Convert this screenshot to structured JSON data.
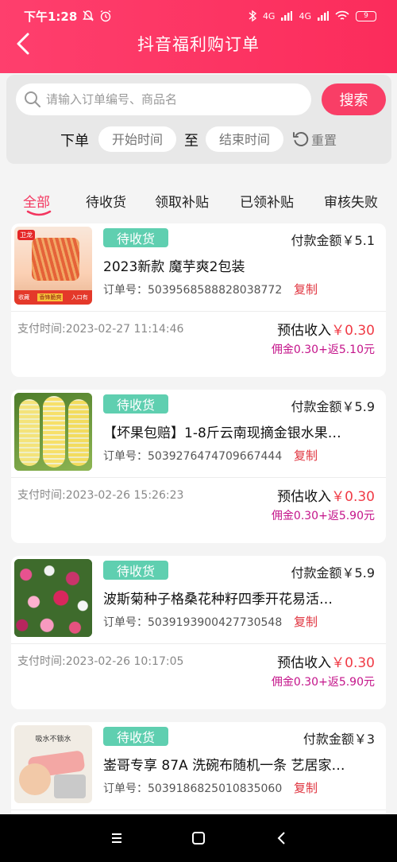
{
  "status_bar": {
    "time": "下午1:28",
    "signal_1": "4G",
    "signal_2": "4G",
    "battery": "9"
  },
  "header": {
    "title": "抖音福利购订单"
  },
  "search": {
    "placeholder": "请输入订单编号、商品名",
    "button_label": "搜索"
  },
  "date_filter": {
    "order_label": "下单",
    "start_placeholder": "开始时间",
    "to_label": "至",
    "end_placeholder": "结束时间",
    "reset_label": "重置"
  },
  "tabs": [
    {
      "label": "全部",
      "active": true
    },
    {
      "label": "待收货",
      "active": false
    },
    {
      "label": "领取补贴",
      "active": false
    },
    {
      "label": "已领补贴",
      "active": false
    },
    {
      "label": "审核失败",
      "active": false
    }
  ],
  "orders": [
    {
      "status": "待收货",
      "payment": "付款金额￥5.1",
      "name": "2023新款 魔芋爽2包装",
      "order_no": "订单号：5039568588828038772",
      "copy_label": "复制",
      "pay_time": "支付时间:2023-02-27 11:14:46",
      "est_label": "预估收入",
      "est_amount": "￥0.30",
      "commission": "佣金0.30+返5.10元",
      "thumb": {
        "brand": "卫龙",
        "caption_1": "收藏",
        "caption_2": "香锋脆爽",
        "caption_3": "入口有"
      }
    },
    {
      "status": "待收货",
      "payment": "付款金额￥5.9",
      "name": "【坏果包赔】1-8斤云南现摘金银水果…",
      "order_no": "订单号：5039276474709667444",
      "copy_label": "复制",
      "pay_time": "支付时间:2023-02-26 15:26:23",
      "est_label": "预估收入",
      "est_amount": "￥0.30",
      "commission": "佣金0.30+返5.90元"
    },
    {
      "status": "待收货",
      "payment": "付款金额￥5.9",
      "name": "波斯菊种子格桑花种籽四季开花易活…",
      "order_no": "订单号：5039193900427730548",
      "copy_label": "复制",
      "pay_time": "支付时间:2023-02-26 10:17:05",
      "est_label": "预估收入",
      "est_amount": "￥0.30",
      "commission": "佣金0.30+返5.90元"
    },
    {
      "status": "待收货",
      "payment": "付款金额￥3",
      "name": "崟哥专享 87A 洗碗布随机一条  艺居家…",
      "order_no": "订单号：5039186825010835060",
      "copy_label": "复制",
      "thumb": {
        "caption": "吸水不锁水"
      }
    }
  ],
  "icons": {
    "back": "chevron-left-icon",
    "search": "magnifier-icon",
    "reset": "refresh-icon",
    "menu": "menu-icon",
    "home": "home-square-icon",
    "nav_back": "back-triangle-icon"
  },
  "colors": {
    "header": "#fb2c5b",
    "search_button": "#f93e66",
    "badge": "#5fcfb0",
    "active_tab": "#f3365f",
    "price": "#f03b46",
    "commission": "#c4148a"
  }
}
